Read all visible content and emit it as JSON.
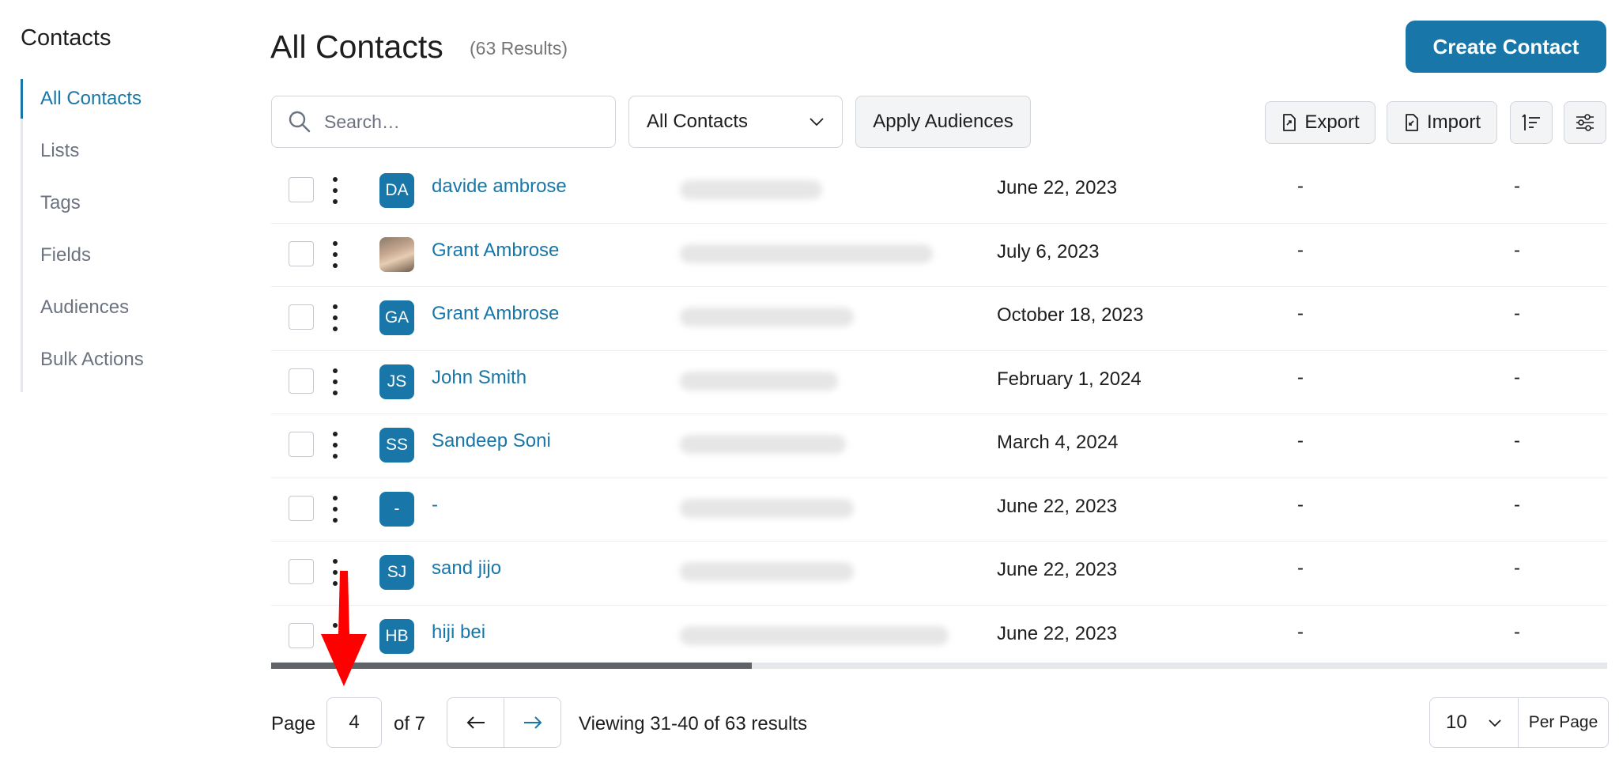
{
  "sidebar": {
    "title": "Contacts",
    "items": [
      {
        "label": "All Contacts",
        "active": true
      },
      {
        "label": "Lists"
      },
      {
        "label": "Tags"
      },
      {
        "label": "Fields"
      },
      {
        "label": "Audiences"
      },
      {
        "label": "Bulk Actions"
      }
    ]
  },
  "header": {
    "title": "All Contacts",
    "result_count": "(63 Results)",
    "create_label": "Create Contact"
  },
  "toolbar": {
    "search_placeholder": "Search…",
    "filter_value": "All Contacts",
    "apply_label": "Apply Audiences",
    "export_label": "Export",
    "import_label": "Import"
  },
  "rows": [
    {
      "initials": "DA",
      "name": "davide ambrose",
      "date": "June 22, 2023",
      "col4": "-",
      "col5": "-"
    },
    {
      "initials": "",
      "name": "Grant Ambrose",
      "date": "July 6, 2023",
      "col4": "-",
      "col5": "-"
    },
    {
      "initials": "GA",
      "name": "Grant Ambrose",
      "date": "October 18, 2023",
      "col4": "-",
      "col5": "-"
    },
    {
      "initials": "JS",
      "name": "John Smith",
      "date": "February 1, 2024",
      "col4": "-",
      "col5": "-"
    },
    {
      "initials": "SS",
      "name": "Sandeep Soni",
      "date": "March 4, 2024",
      "col4": "-",
      "col5": "-"
    },
    {
      "initials": "-",
      "name": "-",
      "date": "June 22, 2023",
      "col4": "-",
      "col5": "-"
    },
    {
      "initials": "SJ",
      "name": "sand jijo",
      "date": "June 22, 2023",
      "col4": "-",
      "col5": "-"
    },
    {
      "initials": "HB",
      "name": "hiji bei",
      "date": "June 22, 2023",
      "col4": "-",
      "col5": "-"
    }
  ],
  "horizontal_scroll_fraction": 0.36,
  "pagination": {
    "page_label": "Page",
    "current_page": "4",
    "of_label": "of 7",
    "viewing": "Viewing 31-40 of 63 results",
    "per_page_value": "10",
    "per_page_label": "Per Page"
  },
  "colors": {
    "accent": "#1877a8",
    "annotation_arrow": "#ff0000"
  }
}
